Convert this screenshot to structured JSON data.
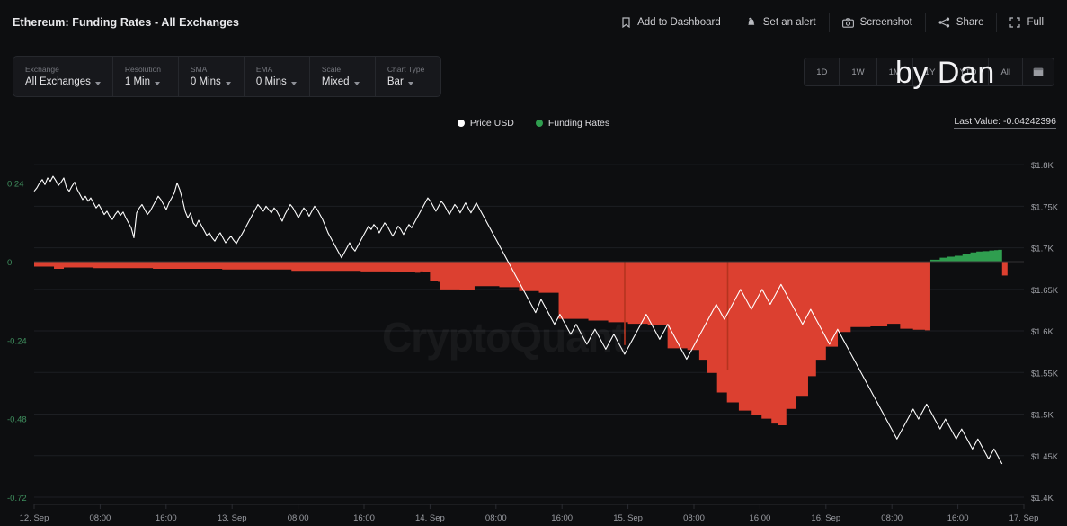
{
  "header": {
    "title": "Ethereum: Funding Rates - All Exchanges",
    "actions": [
      {
        "label": "Add to Dashboard",
        "icon": "bookmark-icon"
      },
      {
        "label": "Set an alert",
        "icon": "bell-icon"
      },
      {
        "label": "Screenshot",
        "icon": "camera-icon"
      },
      {
        "label": "Share",
        "icon": "share-icon"
      },
      {
        "label": "Full",
        "icon": "fullscreen-icon"
      }
    ]
  },
  "toolbar": {
    "fields": [
      {
        "label": "Exchange",
        "value": "All Exchanges"
      },
      {
        "label": "Resolution",
        "value": "1 Min"
      },
      {
        "label": "SMA",
        "value": "0 Mins"
      },
      {
        "label": "EMA",
        "value": "0 Mins"
      },
      {
        "label": "Scale",
        "value": "Mixed"
      },
      {
        "label": "Chart Type",
        "value": "Bar"
      }
    ]
  },
  "range": {
    "buttons": [
      "1D",
      "1W",
      "1M",
      "1Y",
      "YTD",
      "All"
    ],
    "calendar_icon": "calendar-icon"
  },
  "legend": {
    "items": [
      {
        "label": "Price USD",
        "color": "#ffffff"
      },
      {
        "label": "Funding Rates",
        "color": "#2f9e4f"
      }
    ]
  },
  "last_value": "Last Value: -0.04242396",
  "watermarks": {
    "chart": "CryptoQuant",
    "author": "by Dan"
  },
  "colors": {
    "background": "#0d0e10",
    "panel": "#17181c",
    "border": "#26282d",
    "negative": "#dc4030",
    "positive": "#2f9e4f",
    "price_line": "#ffffff",
    "left_axis_text": "#3f8f5e",
    "right_axis_text": "#9fa1a7",
    "grid": "#1d1f23"
  },
  "chart_data": {
    "type": "line",
    "title": "Ethereum: Funding Rates - All Exchanges",
    "xlabel": "",
    "ylabel": "Funding Rates",
    "y2label": "Price USD",
    "grid": true,
    "legend_position": "top-center",
    "x_ticks": [
      "12. Sep",
      "08:00",
      "16:00",
      "13. Sep",
      "08:00",
      "16:00",
      "14. Sep",
      "08:00",
      "16:00",
      "15. Sep",
      "08:00",
      "16:00",
      "16. Sep",
      "08:00",
      "16:00",
      "17. Sep"
    ],
    "left_axis": {
      "label": "Funding Rates",
      "ticks": [
        0.24,
        0,
        -0.24,
        -0.48,
        -0.72
      ],
      "tick_labels": [
        "0.24",
        "0",
        "-0.24",
        "-0.48",
        "-0.72"
      ],
      "ylim": [
        -0.72,
        0.36
      ]
    },
    "right_axis": {
      "label": "Price USD",
      "ticks": [
        1800,
        1750,
        1700,
        1650,
        1600,
        1550,
        1500,
        1450,
        1400
      ],
      "tick_labels": [
        "$1.8K",
        "$1.75K",
        "$1.7K",
        "$1.65K",
        "$1.6K",
        "$1.55K",
        "$1.5K",
        "$1.45K",
        "$1.4K"
      ],
      "ylim": [
        1400,
        1825
      ]
    },
    "series": [
      {
        "name": "Price USD",
        "type": "line",
        "color": "#ffffff",
        "axis": "right",
        "unit": "USD",
        "values": [
          1768,
          1772,
          1778,
          1782,
          1776,
          1784,
          1780,
          1786,
          1781,
          1775,
          1779,
          1784,
          1772,
          1768,
          1774,
          1779,
          1770,
          1764,
          1758,
          1762,
          1756,
          1760,
          1754,
          1748,
          1752,
          1746,
          1740,
          1744,
          1738,
          1734,
          1740,
          1744,
          1739,
          1743,
          1736,
          1730,
          1724,
          1712,
          1742,
          1748,
          1752,
          1746,
          1740,
          1744,
          1750,
          1756,
          1762,
          1758,
          1752,
          1746,
          1754,
          1760,
          1766,
          1778,
          1770,
          1758,
          1744,
          1736,
          1742,
          1730,
          1726,
          1733,
          1727,
          1721,
          1715,
          1718,
          1712,
          1708,
          1714,
          1718,
          1712,
          1706,
          1710,
          1714,
          1709,
          1705,
          1711,
          1716,
          1722,
          1728,
          1734,
          1740,
          1746,
          1752,
          1748,
          1744,
          1750,
          1746,
          1742,
          1748,
          1744,
          1738,
          1732,
          1740,
          1746,
          1752,
          1748,
          1742,
          1736,
          1742,
          1748,
          1744,
          1738,
          1744,
          1750,
          1746,
          1740,
          1734,
          1726,
          1718,
          1712,
          1706,
          1700,
          1694,
          1688,
          1694,
          1700,
          1706,
          1700,
          1696,
          1702,
          1708,
          1714,
          1720,
          1726,
          1722,
          1728,
          1724,
          1718,
          1724,
          1730,
          1726,
          1720,
          1714,
          1720,
          1726,
          1722,
          1716,
          1722,
          1728,
          1724,
          1730,
          1736,
          1742,
          1748,
          1754,
          1760,
          1756,
          1750,
          1744,
          1750,
          1756,
          1752,
          1746,
          1740,
          1746,
          1752,
          1748,
          1742,
          1748,
          1754,
          1748,
          1742,
          1748,
          1754,
          1748,
          1742,
          1736,
          1730,
          1724,
          1718,
          1712,
          1706,
          1700,
          1694,
          1688,
          1682,
          1676,
          1670,
          1664,
          1658,
          1652,
          1646,
          1640,
          1634,
          1628,
          1622,
          1630,
          1638,
          1632,
          1626,
          1620,
          1614,
          1608,
          1614,
          1620,
          1614,
          1608,
          1602,
          1596,
          1602,
          1608,
          1602,
          1596,
          1590,
          1584,
          1590,
          1596,
          1602,
          1596,
          1590,
          1584,
          1578,
          1584,
          1590,
          1596,
          1590,
          1584,
          1578,
          1572,
          1578,
          1584,
          1590,
          1596,
          1602,
          1608,
          1614,
          1620,
          1614,
          1608,
          1602,
          1596,
          1590,
          1596,
          1602,
          1608,
          1602,
          1596,
          1590,
          1584,
          1578,
          1572,
          1566,
          1572,
          1578,
          1584,
          1590,
          1596,
          1602,
          1608,
          1614,
          1620,
          1626,
          1632,
          1626,
          1620,
          1614,
          1620,
          1626,
          1632,
          1638,
          1644,
          1650,
          1644,
          1638,
          1632,
          1626,
          1632,
          1638,
          1644,
          1650,
          1644,
          1638,
          1632,
          1638,
          1644,
          1650,
          1656,
          1650,
          1644,
          1638,
          1632,
          1626,
          1620,
          1614,
          1608,
          1614,
          1620,
          1626,
          1620,
          1614,
          1608,
          1602,
          1596,
          1590,
          1584,
          1590,
          1596,
          1602,
          1596,
          1590,
          1584,
          1578,
          1572,
          1566,
          1560,
          1554,
          1548,
          1542,
          1536,
          1530,
          1524,
          1518,
          1512,
          1506,
          1500,
          1494,
          1488,
          1482,
          1476,
          1470,
          1476,
          1482,
          1488,
          1494,
          1500,
          1506,
          1500,
          1494,
          1500,
          1506,
          1512,
          1506,
          1500,
          1494,
          1488,
          1482,
          1488,
          1494,
          1488,
          1482,
          1476,
          1470,
          1476,
          1482,
          1476,
          1470,
          1464,
          1458,
          1464,
          1470,
          1464,
          1458,
          1452,
          1446,
          1452,
          1458,
          1452,
          1446,
          1440
        ]
      },
      {
        "name": "Funding Rates",
        "type": "bar",
        "color_positive": "#2f9e4f",
        "color_negative": "#dc4030",
        "axis": "left",
        "description": "Mostly negative funding rates for 12-16 Sep, deepening to about -0.50 on 15 Sep, flipping positive (about +0.03) on 16 Sep, ending negative at -0.04242396",
        "values_summary": {
          "start_level": -0.015,
          "mid_level": -0.09,
          "deepest": -0.5,
          "positive_peak": 0.035,
          "last_value": -0.04242396
        }
      }
    ],
    "annotations": [
      {
        "text": "Last Value: -0.04242396",
        "position": "top-right"
      }
    ]
  }
}
